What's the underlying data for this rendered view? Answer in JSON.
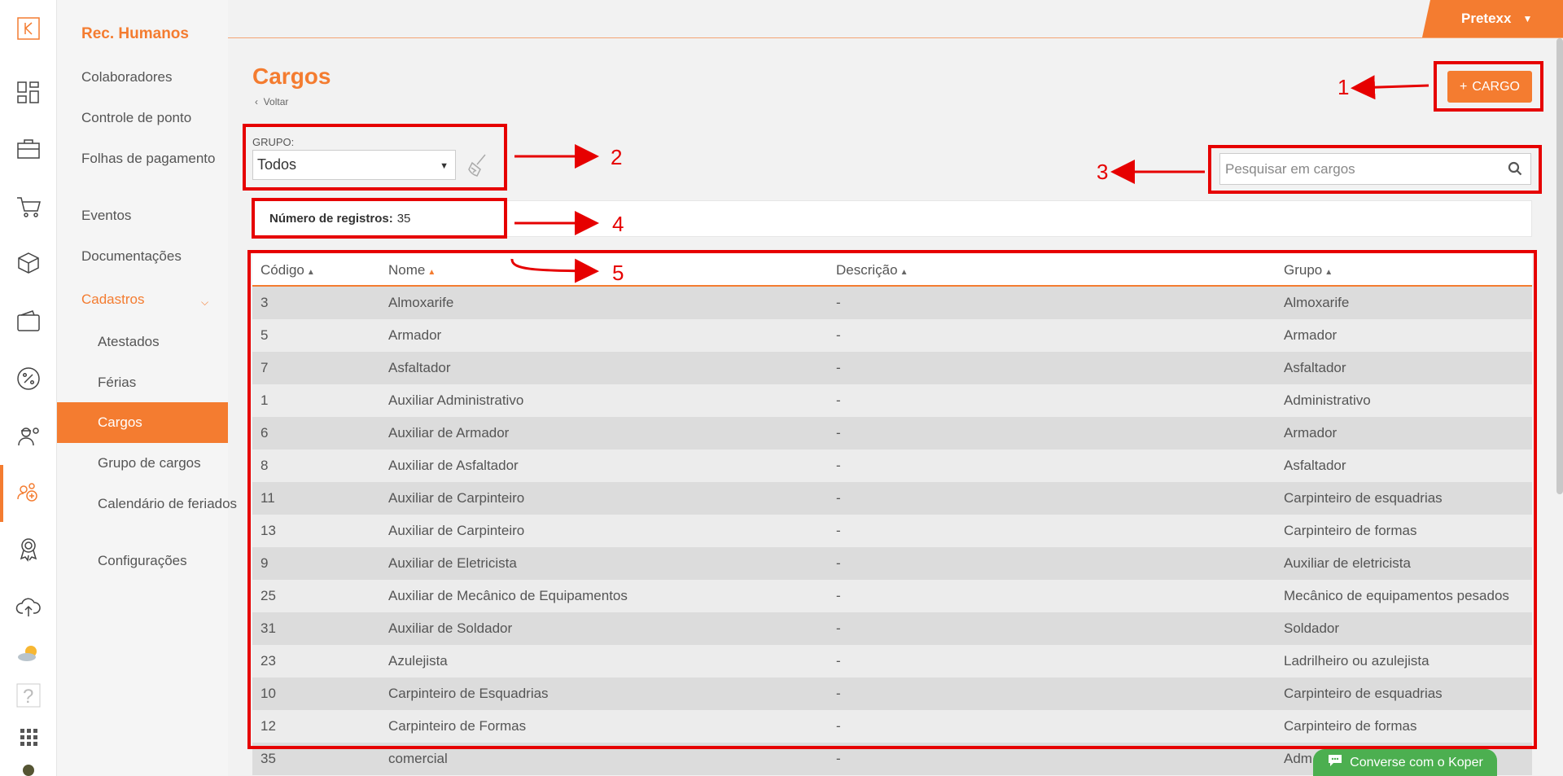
{
  "submenu": {
    "title": "Rec. Humanos",
    "items": [
      "Colaboradores",
      "Controle de ponto",
      "Folhas de pagamento",
      "Eventos",
      "Documentações"
    ],
    "cadastros": "Cadastros",
    "sub_items": [
      "Atestados",
      "Férias",
      "Cargos",
      "Grupo de cargos",
      "Calendário de feriados",
      "Configurações"
    ]
  },
  "topbar": {
    "user": "Pretexx"
  },
  "page": {
    "title": "Cargos",
    "back": "Voltar",
    "add_button": "CARGO"
  },
  "filter": {
    "label": "GRUPO:",
    "value": "Todos"
  },
  "search": {
    "placeholder": "Pesquisar em cargos"
  },
  "count": {
    "label": "Número de registros:",
    "value": "35"
  },
  "table": {
    "headers": [
      "Código",
      "Nome",
      "Descrição",
      "Grupo"
    ],
    "rows": [
      [
        "3",
        "Almoxarife",
        "-",
        "Almoxarife"
      ],
      [
        "5",
        "Armador",
        "-",
        "Armador"
      ],
      [
        "7",
        "Asfaltador",
        "-",
        "Asfaltador"
      ],
      [
        "1",
        "Auxiliar Administrativo",
        "-",
        "Administrativo"
      ],
      [
        "6",
        "Auxiliar de Armador",
        "-",
        "Armador"
      ],
      [
        "8",
        "Auxiliar de Asfaltador",
        "-",
        "Asfaltador"
      ],
      [
        "11",
        "Auxiliar de Carpinteiro",
        "-",
        "Carpinteiro de esquadrias"
      ],
      [
        "13",
        "Auxiliar de Carpinteiro",
        "-",
        "Carpinteiro de formas"
      ],
      [
        "9",
        "Auxiliar de Eletricista",
        "-",
        "Auxiliar de eletricista"
      ],
      [
        "25",
        "Auxiliar de Mecânico de Equipamentos",
        "-",
        "Mecânico de equipamentos pesados"
      ],
      [
        "31",
        "Auxiliar de Soldador",
        "-",
        "Soldador"
      ],
      [
        "23",
        "Azulejista",
        "-",
        "Ladrilheiro ou azulejista"
      ],
      [
        "10",
        "Carpinteiro de Esquadrias",
        "-",
        "Carpinteiro de esquadrias"
      ],
      [
        "12",
        "Carpinteiro de Formas",
        "-",
        "Carpinteiro de formas"
      ],
      [
        "35",
        "comercial",
        "-",
        "Adm"
      ]
    ]
  },
  "annotations": [
    "1",
    "2",
    "3",
    "4",
    "5"
  ],
  "chat": {
    "label": "Converse com o Koper"
  },
  "colors": {
    "accent": "#f47c30",
    "annotation": "#e60000",
    "chat": "#4caf50"
  }
}
